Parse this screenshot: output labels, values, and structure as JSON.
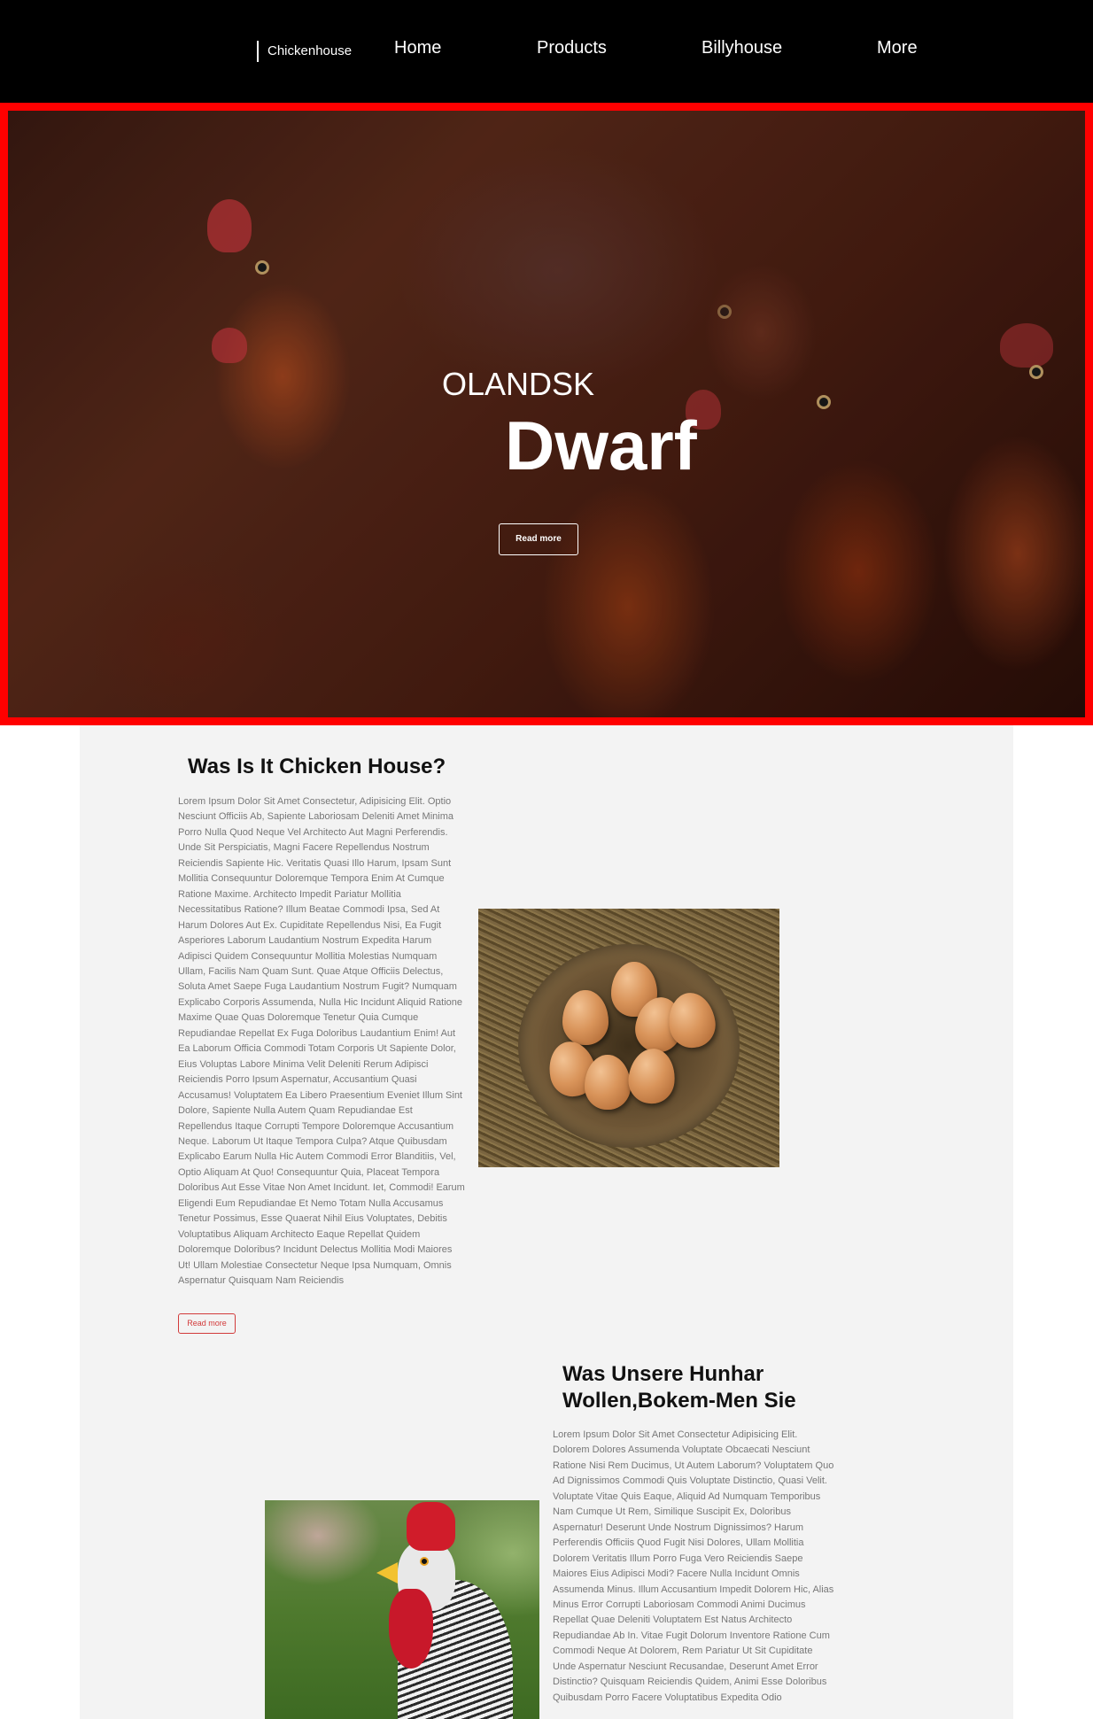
{
  "nav": {
    "brand": "Chickenhouse",
    "links": [
      "Home",
      "Products",
      "Billyhouse",
      "More"
    ]
  },
  "hero": {
    "eyebrow": "OLANDSK",
    "title": "Dwarf",
    "button": "Read more"
  },
  "section1": {
    "title": "Was Is It Chicken House?",
    "body": "Lorem Ipsum Dolor Sit Amet Consectetur, Adipisicing Elit. Optio Nesciunt Officiis Ab, Sapiente Laboriosam Deleniti Amet Minima Porro Nulla Quod Neque Vel Architecto Aut Magni Perferendis. Unde Sit Perspiciatis, Magni Facere Repellendus Nostrum Reiciendis Sapiente Hic. Veritatis Quasi Illo Harum, Ipsam Sunt Mollitia Consequuntur Doloremque Tempora Enim At Cumque Ratione Maxime. Architecto Impedit Pariatur Mollitia Necessitatibus Ratione? Illum Beatae Commodi Ipsa, Sed At Harum Dolores Aut Ex. Cupiditate Repellendus Nisi, Ea Fugit Asperiores Laborum Laudantium Nostrum Expedita Harum Adipisci Quidem Consequuntur Mollitia Molestias Numquam Ullam, Facilis Nam Quam Sunt. Quae Atque Officiis Delectus, Soluta Amet Saepe Fuga Laudantium Nostrum Fugit? Numquam Explicabo Corporis Assumenda, Nulla Hic Incidunt Aliquid Ratione Maxime Quae Quas Doloremque Tenetur Quia Cumque Repudiandae Repellat Ex Fuga Doloribus Laudantium Enim! Aut Ea Laborum Officia Commodi Totam Corporis Ut Sapiente Dolor, Eius Voluptas Labore Minima Velit Deleniti Rerum Adipisci Reiciendis Porro Ipsum Aspernatur, Accusantium Quasi Accusamus! Voluptatem Ea Libero Praesentium Eveniet Illum Sint Dolore, Sapiente Nulla Autem Quam Repudiandae Est Repellendus Itaque Corrupti Tempore Doloremque Accusantium Neque. Laborum Ut Itaque Tempora Culpa? Atque Quibusdam Explicabo Earum Nulla Hic Autem Commodi Error Blanditiis, Vel, Optio Aliquam At Quo! Consequuntur Quia, Placeat Tempora Doloribus Aut Esse Vitae Non Amet Incidunt. Iet, Commodi! Earum Eligendi Eum Repudiandae Et Nemo Totam Nulla Accusamus Tenetur Possimus, Esse Quaerat Nihil Eius Voluptates, Debitis Voluptatibus Aliquam Architecto Eaque Repellat Quidem Doloremque Doloribus? Incidunt Delectus Mollitia Modi Maiores Ut! Ullam Molestiae Consectetur Neque Ipsa Numquam, Omnis Aspernatur Quisquam Nam Reiciendis",
    "button": "Read more"
  },
  "section2": {
    "title": "Was Unsere Hunhar Wollen,Bokem-Men Sie",
    "body": "Lorem Ipsum Dolor Sit Amet Consectetur Adipisicing Elit. Dolorem Dolores Assumenda Voluptate Obcaecati Nesciunt Ratione Nisi Rem Ducimus, Ut Autem Laborum? Voluptatem Quo Ad Dignissimos Commodi Quis Voluptate Distinctio, Quasi Velit. Voluptate Vitae Quis Eaque, Aliquid Ad Numquam Temporibus Nam Cumque Ut Rem, Similique Suscipit Ex, Doloribus Aspernatur! Deserunt Unde Nostrum Dignissimos? Harum Perferendis Officiis Quod Fugit Nisi Dolores, Ullam Mollitia Dolorem Veritatis Illum Porro Fuga Vero Reiciendis Saepe Maiores Eius Adipisci Modi? Facere Nulla Incidunt Omnis Assumenda Minus. Illum Accusantium Impedit Dolorem Hic, Alias Minus Error Corrupti Laboriosam Commodi Animi Ducimus Repellat Quae Deleniti Voluptatem Est Natus Architecto Repudiandae Ab In. Vitae Fugit Dolorum Inventore Ratione Cum Commodi Neque At Dolorem, Rem Pariatur Ut Sit Cupiditate Unde Aspernatur Nesciunt Recusandae, Deserunt Amet Error Distinctio? Quisquam Reiciendis Quidem, Animi Esse Doloribus Quibusdam Porro Facere Voluptatibus Expedita Odio"
  },
  "colors": {
    "nav_bg": "#000000",
    "hero_border": "#ff0000",
    "panel_bg": "#f3f3f3",
    "accent_button": "#d23a3a",
    "body_text": "#777777"
  },
  "images": {
    "hero": "hens-photo",
    "section1": "eggs-in-basket-photo",
    "section2": "rooster-photo"
  }
}
